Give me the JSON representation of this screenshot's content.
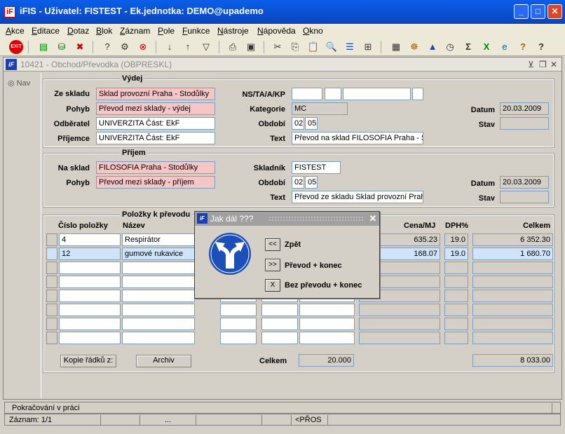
{
  "window": {
    "title": "iFIS - Uživatel: FISTEST - Ek.jednotka: DEMO@upademo",
    "app_icon": "iF"
  },
  "menu": [
    "Akce",
    "Editace",
    "Dotaz",
    "Blok",
    "Záznam",
    "Pole",
    "Funkce",
    "Nástroje",
    "Nápověda",
    "Okno"
  ],
  "form": {
    "title": "10421 - Obchod/Převodka (OBPRESKL)",
    "nav_label": "Nav",
    "vydej": {
      "group_title": "Výdej",
      "ze_skladu_label": "Ze skladu",
      "ze_skladu": "Sklad provozní Praha - Stodůlky",
      "pohyb_label": "Pohyb",
      "pohyb": "Převod mezi sklady - výdej",
      "odberatel_label": "Odběratel",
      "odberatel": "UNIVERZITA Část: EkF",
      "prijemce_label": "Příjemce",
      "prijemce": "UNIVERZITA Část: EkF",
      "ns_label": "NS/TA/A/KP",
      "kategorie_label": "Kategorie",
      "kategorie": "MC",
      "obdobi_label": "Období",
      "obdobi_1": "02",
      "obdobi_2": "05",
      "text_label": "Text",
      "text": "Převod na sklad FILOSOFIA Praha - St",
      "datum_label": "Datum",
      "datum": "20.03.2009",
      "stav_label": "Stav",
      "stav": ""
    },
    "prijem": {
      "group_title": "Příjem",
      "na_sklad_label": "Na sklad",
      "na_sklad": "FILOSOFIA Praha - Stodůlky",
      "pohyb_label": "Pohyb",
      "pohyb": "Převod mezi sklady - příjem",
      "skladnik_label": "Skladník",
      "skladnik": "FISTEST",
      "obdobi_label": "Období",
      "obdobi_1": "02",
      "obdobi_2": "05",
      "text_label": "Text",
      "text": "Převod ze skladu Sklad provozní Prah",
      "datum_label": "Datum",
      "datum": "20.03.2009",
      "stav_label": "Stav",
      "stav": ""
    },
    "polozky": {
      "group_title": "Položky k převodu",
      "col_cislo": "Číslo položky",
      "col_nazev": "Název",
      "col_cena": "Cena/MJ",
      "col_dph": "DPH%",
      "col_celkem": "Celkem",
      "rows": [
        {
          "cislo": "4",
          "nazev": "Respirátor",
          "cena": "635.23",
          "dph": "19.0",
          "celkem": "6 352.30"
        },
        {
          "cislo": "12",
          "nazev": "gumové rukavice",
          "cena": "168.07",
          "dph": "19.0",
          "celkem": "1 680.70"
        }
      ],
      "kopie_button": "Kopie řádků z:",
      "archiv_button": "Archiv",
      "celkem_label": "Celkem",
      "celkem_qty": "20.000",
      "celkem_total": "8 033.00"
    }
  },
  "status": {
    "message": "Pokračování v práci",
    "record": "Záznam: 1/1",
    "ellipsis": "...",
    "mode": "<PŘOS"
  },
  "dialog": {
    "title": "Jak dál ???",
    "options": [
      {
        "button": "<<",
        "label": "Zpět"
      },
      {
        "button": ">>",
        "label": "Převod + konec"
      },
      {
        "button": "X",
        "label": "Bez převodu + konec"
      }
    ]
  }
}
